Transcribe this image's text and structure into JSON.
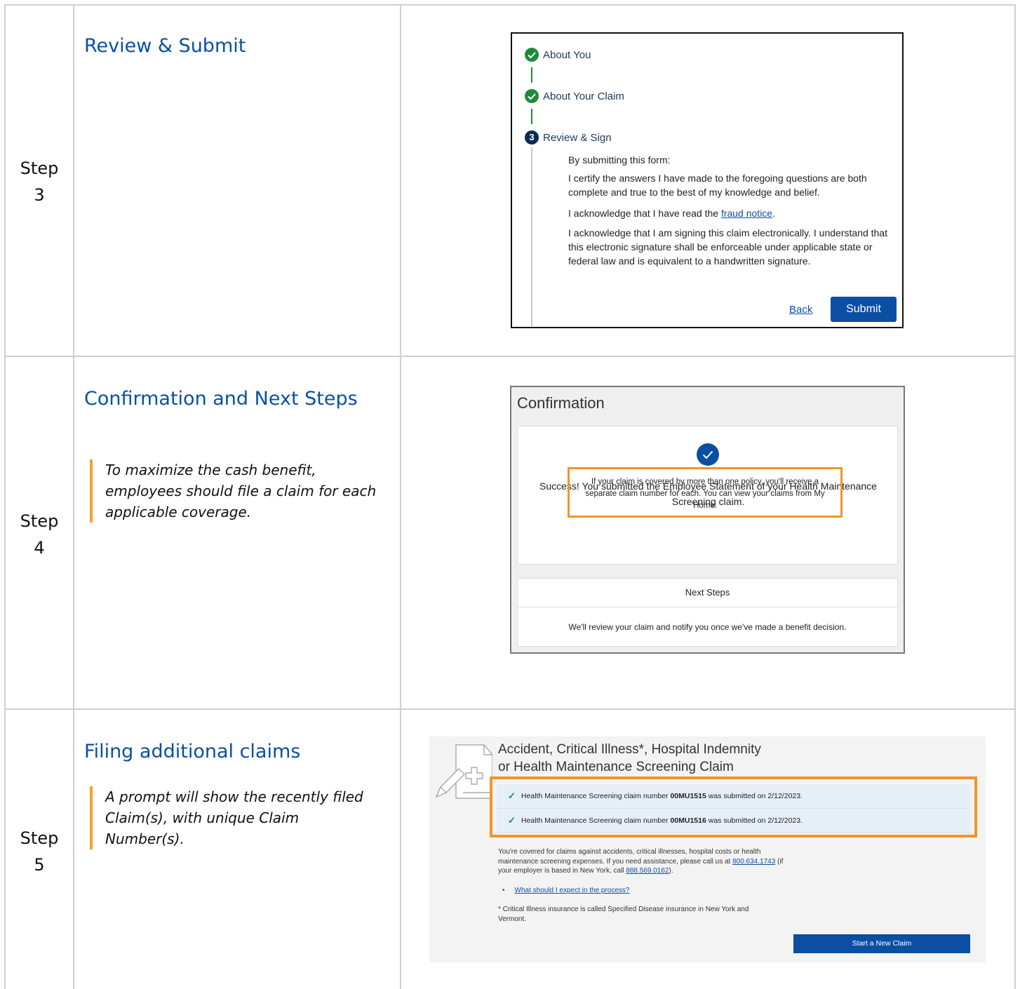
{
  "steps": [
    {
      "label_line1": "Step",
      "label_line2": "3",
      "title": "Review & Submit"
    },
    {
      "label_line1": "Step",
      "label_line2": "4",
      "title": "Confirmation and Next Steps",
      "note": "To maximize the cash benefit, employees should file a claim for each applicable coverage."
    },
    {
      "label_line1": "Step",
      "label_line2": "5",
      "title": "Filing additional claims",
      "note": "A prompt will show the recently filed Claim(s), with unique Claim Number(s)."
    }
  ],
  "review": {
    "stepper": [
      {
        "label": "About You",
        "status": "done"
      },
      {
        "label": "About Your Claim",
        "status": "done"
      },
      {
        "label": "Review & Sign",
        "status": "current",
        "number": "3"
      }
    ],
    "intro": "By submitting this form:",
    "certify": "I certify the answers I have made to the foregoing questions are both complete and true to the best of my knowledge and belief.",
    "ack_prefix": "I acknowledge that I have read the ",
    "fraud_link": "fraud notice",
    "ack_suffix": ".",
    "esign": "I acknowledge that I am signing this claim electronically. I understand that this electronic signature shall be enforceable under applicable state or federal law and is equivalent to a handwritten signature.",
    "back_label": "Back",
    "submit_label": "Submit"
  },
  "confirmation": {
    "heading": "Confirmation",
    "success": "Success! You submitted the Employee Statement of your Health Maintenance Screening claim.",
    "policy_note": "If your claim is covered by more than one policy, you'll receive a separate claim number for each. You can view your claims from My Home.",
    "next_steps": "Next Steps",
    "review_msg": "We'll review your claim and notify you once we've made a benefit decision."
  },
  "claims": {
    "title_line1": "Accident, Critical Illness*, Hospital Indemnity",
    "title_line2": "or Health Maintenance Screening Claim",
    "rows": [
      {
        "prefix": "Health Maintenance Screening claim number ",
        "number": "00MU1515",
        "suffix": " was submitted on 2/12/2023."
      },
      {
        "prefix": "Health Maintenance Screening claim number ",
        "number": "00MU1516",
        "suffix": " was submitted on 2/12/2023."
      }
    ],
    "body_text": "You're covered for claims against accidents, critical illnesses, hospital costs or health maintenance screening expenses. If you need assistance, please call us at ",
    "phone1": "800.634.1743",
    "body_mid": " (if your employer is based in New York, call ",
    "phone2": "888.569.0162",
    "body_end": ").",
    "process_link": "What should I expect in the process?",
    "footnote": "* Critical Illness insurance is called Specified Disease insurance in New York and Vermont.",
    "start_label": "Start a New Claim"
  },
  "colors": {
    "accent": "#0b4fa3",
    "highlight": "#f0952b",
    "success": "#1e8b3a"
  }
}
